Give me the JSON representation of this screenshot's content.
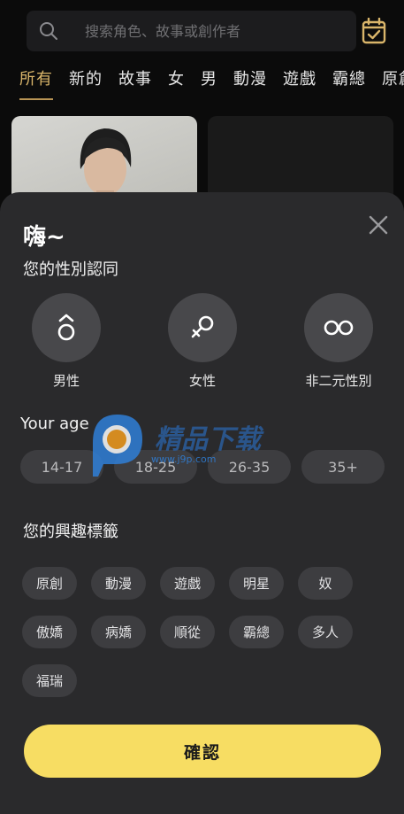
{
  "search": {
    "placeholder": "搜索角色、故事或創作者"
  },
  "categories": [
    "所有",
    "新的",
    "故事",
    "女",
    "男",
    "動漫",
    "遊戲",
    "霸總",
    "原創"
  ],
  "sheet": {
    "greeting": "嗨~",
    "gender_title": "您的性別認同",
    "genders": [
      {
        "label": "男性",
        "icon": "male-icon"
      },
      {
        "label": "女性",
        "icon": "female-icon"
      },
      {
        "label": "非二元性別",
        "icon": "nonbinary-icon"
      }
    ],
    "age_title": "Your age",
    "ages": [
      "14-17",
      "18-25",
      "26-35",
      "35+"
    ],
    "interest_title": "您的興趣標籤",
    "interests": [
      [
        "原創",
        "動漫",
        "遊戲",
        "明星",
        "奴"
      ],
      [
        "傲嬌",
        "病嬌",
        "順從",
        "霸總",
        "多人"
      ],
      [
        "福瑞"
      ]
    ],
    "confirm_label": "確認"
  },
  "watermark": {
    "brand": "精品下载",
    "url": "www.j9p.com"
  },
  "colors": {
    "accent": "#d9b56a",
    "confirm": "#f7dd63",
    "sheet": "#2a2a2c",
    "chip": "#3d3d40"
  }
}
